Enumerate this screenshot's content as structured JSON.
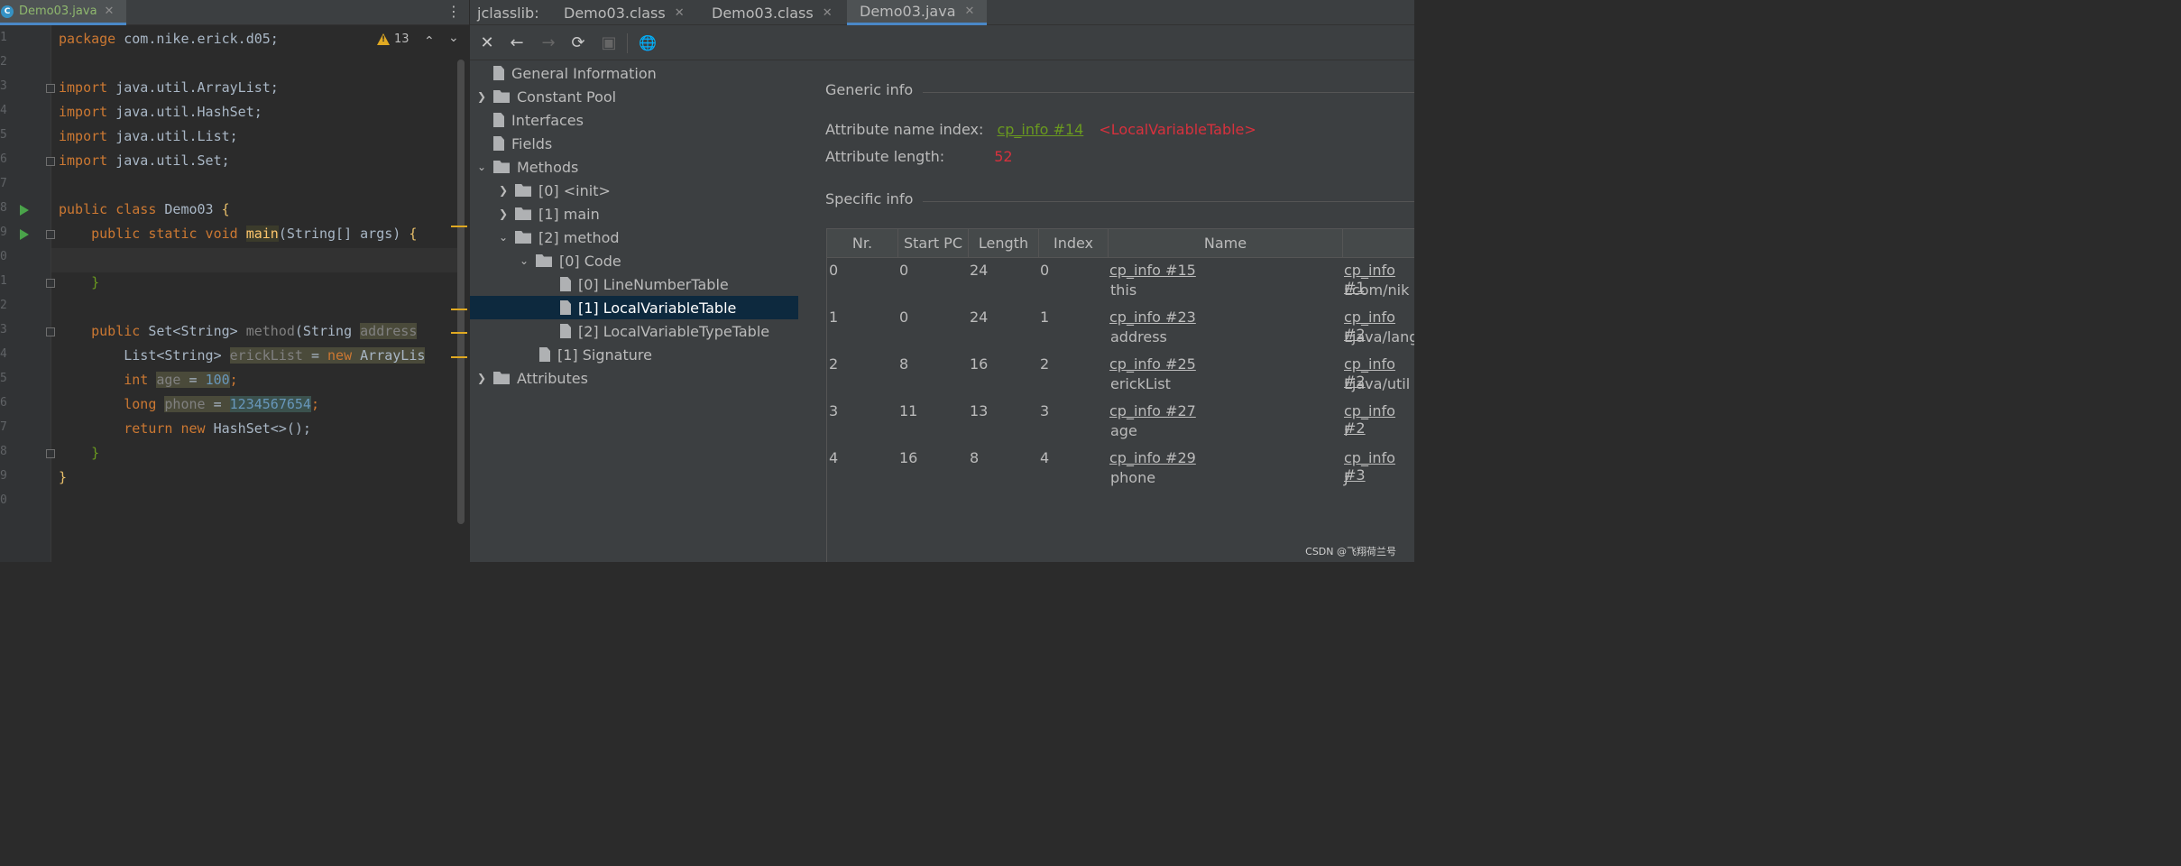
{
  "editor": {
    "tab": {
      "icon": "C",
      "label": "Demo03.java",
      "close": "✕"
    },
    "warnings": {
      "count": "13"
    },
    "line_numbers": [
      "1",
      "2",
      "3",
      "4",
      "5",
      "6",
      "7",
      "8",
      "9",
      "0",
      "1",
      "2",
      "3",
      "4",
      "5",
      "6",
      "7",
      "8",
      "9",
      "0"
    ],
    "code": {
      "l1_kw": "package",
      "l1_rest": " com.nike.erick.d05;",
      "l3_kw": "import",
      "l3_rest": " java.util.ArrayList;",
      "l4_kw": "import",
      "l4_rest": " java.util.HashSet;",
      "l5_kw": "import",
      "l5_rest": " java.util.List;",
      "l6_kw": "import",
      "l6_rest": " java.util.Set;",
      "l8_kw": "public class",
      "l8_name": " Demo03 ",
      "l8_brace": "{",
      "l9_kw": "    public static void ",
      "l9_fn": "main",
      "l9_rest": "(String[] args) ",
      "l9_brace": "{",
      "l11_brace": "    }",
      "l13_kw": "    public ",
      "l13_type": "Set<String> ",
      "l13_fn": "method",
      "l13_rest": "(String ",
      "l13_param": "address",
      "l14_type": "        List<String> ",
      "l14_var": "erickList",
      "l14_eq": " = ",
      "l14_kw": "new",
      "l14_rest": " ArrayLis",
      "l15_kw": "        int ",
      "l15_var": "age",
      "l15_eq": " = ",
      "l15_num": "100",
      "l15_semi": ";",
      "l16_kw": "        long ",
      "l16_var": "phone",
      "l16_eq": " = ",
      "l16_num": "1234567654",
      "l16_semi": ";",
      "l17_kw": "        return new ",
      "l17_rest": "HashSet<>();",
      "l18_brace": "    }",
      "l19_brace": "}"
    }
  },
  "jclasslib": {
    "tabs": [
      {
        "label": "jclasslib:"
      },
      {
        "label": "Demo03.class",
        "close": "✕"
      },
      {
        "label": "Demo03.class",
        "close": "✕"
      },
      {
        "label": "Demo03.java",
        "close": "✕"
      }
    ],
    "toolbar": {
      "close": "✕",
      "back": "←",
      "forward": "→",
      "refresh": "⟳",
      "save": "▣",
      "web": "🌐"
    },
    "tree": {
      "general": "General Information",
      "constant_pool": "Constant Pool",
      "interfaces": "Interfaces",
      "fields": "Fields",
      "methods": "Methods",
      "m0": "[0] <init>",
      "m1": "[1] main",
      "m2": "[2] method",
      "code": "[0] Code",
      "lnt": "[0] LineNumberTable",
      "lvt": "[1] LocalVariableTable",
      "lvtt": "[2] LocalVariableTypeTable",
      "signature": "[1] Signature",
      "attributes": "Attributes"
    },
    "detail": {
      "generic_title": "Generic info",
      "name_index_label": "Attribute name index:",
      "name_index_link": "cp_info #14",
      "name_index_value": "<LocalVariableTable>",
      "length_label": "Attribute length:",
      "length_value": "52",
      "specific_title": "Specific info",
      "columns": [
        "Nr.",
        "Start PC",
        "Length",
        "Index",
        "Name"
      ],
      "rows": [
        {
          "nr": "0",
          "start": "0",
          "len": "24",
          "idx": "0",
          "name_link": "cp_info #15",
          "name": "this",
          "desc_link": "cp_info #1",
          "desc": "Lcom/nik"
        },
        {
          "nr": "1",
          "start": "0",
          "len": "24",
          "idx": "1",
          "name_link": "cp_info #23",
          "name": "address",
          "desc_link": "cp_info #2",
          "desc": "Ljava/lang"
        },
        {
          "nr": "2",
          "start": "8",
          "len": "16",
          "idx": "2",
          "name_link": "cp_info #25",
          "name": "erickList",
          "desc_link": "cp_info #2",
          "desc": "Ljava/util"
        },
        {
          "nr": "3",
          "start": "11",
          "len": "13",
          "idx": "3",
          "name_link": "cp_info #27",
          "name": "age",
          "desc_link": "cp_info #2",
          "desc": "I"
        },
        {
          "nr": "4",
          "start": "16",
          "len": "8",
          "idx": "4",
          "name_link": "cp_info #29",
          "name": "phone",
          "desc_link": "cp_info #3",
          "desc": "J"
        }
      ]
    }
  },
  "watermark": "CSDN @飞翔荷兰号",
  "colors": {
    "keyword": "#cc7832",
    "link_green": "#6a9a1f",
    "value_red": "#d7313d",
    "selection": "#0d293e"
  }
}
